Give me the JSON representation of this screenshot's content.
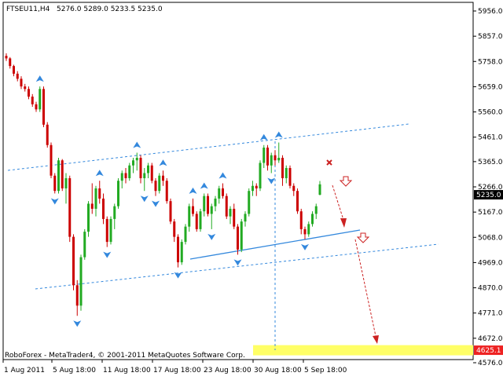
{
  "header": {
    "symbol_timeframe": "FTSEU11,H4",
    "ohlc": "5276.0 5289.0 5233.5 5235.0"
  },
  "footer": {
    "copyright": "RoboForex - MetaTrader4, © 2001-2011 MetaQuotes Software Corp."
  },
  "colors": {
    "background": "#ffffff",
    "candle_up": "#22aa22",
    "candle_down": "#cc0000",
    "trend_line": "#2277dd",
    "arrow": "#cc2222",
    "fractal": "#3388dd",
    "target_zone": "#ffff66",
    "current_price_label": "#000000",
    "target_price_label": "#ee2222"
  },
  "chart_data": {
    "type": "candlestick",
    "ylim": [
      4576.0,
      5956.0
    ],
    "y_ticks": [
      "5956.0",
      "5857.0",
      "5758.0",
      "5659.0",
      "5560.0",
      "5461.0",
      "5365.0",
      "5266.0",
      "5167.0",
      "5068.0",
      "4969.0",
      "4870.0",
      "4771.0",
      "4672.0",
      "4576.0"
    ],
    "x_labels": [
      "1 Aug 2011",
      "5 Aug 18:00",
      "11 Aug 18:00",
      "17 Aug 18:00",
      "23 Aug 18:00",
      "30 Aug 18:00",
      "5 Sep 18:00"
    ],
    "current_price": "5235.0",
    "target_price": "4625.1",
    "target_zone": [
      4605,
      4645
    ],
    "candles": [
      [
        5780,
        5790,
        5760,
        5770
      ],
      [
        5770,
        5775,
        5730,
        5740
      ],
      [
        5740,
        5745,
        5700,
        5710
      ],
      [
        5710,
        5720,
        5680,
        5690
      ],
      [
        5690,
        5700,
        5650,
        5660
      ],
      [
        5660,
        5670,
        5640,
        5650
      ],
      [
        5650,
        5660,
        5610,
        5620
      ],
      [
        5620,
        5630,
        5580,
        5590
      ],
      [
        5590,
        5600,
        5560,
        5570
      ],
      [
        5570,
        5660,
        5560,
        5650
      ],
      [
        5650,
        5660,
        5500,
        5510
      ],
      [
        5510,
        5520,
        5420,
        5430
      ],
      [
        5430,
        5440,
        5300,
        5310
      ],
      [
        5310,
        5320,
        5240,
        5250
      ],
      [
        5250,
        5380,
        5240,
        5370
      ],
      [
        5370,
        5375,
        5250,
        5260
      ],
      [
        5260,
        5320,
        5200,
        5300
      ],
      [
        5300,
        5310,
        5050,
        5070
      ],
      [
        5070,
        5080,
        4860,
        4880
      ],
      [
        4880,
        4900,
        4760,
        4800
      ],
      [
        4800,
        5000,
        4780,
        4990
      ],
      [
        4990,
        5100,
        4980,
        5090
      ],
      [
        5090,
        5210,
        5070,
        5200
      ],
      [
        5200,
        5280,
        5160,
        5180
      ],
      [
        5180,
        5270,
        5150,
        5260
      ],
      [
        5260,
        5290,
        5200,
        5220
      ],
      [
        5220,
        5240,
        5120,
        5140
      ],
      [
        5140,
        5150,
        5030,
        5050
      ],
      [
        5050,
        5150,
        5040,
        5140
      ],
      [
        5140,
        5200,
        5100,
        5190
      ],
      [
        5190,
        5300,
        5180,
        5290
      ],
      [
        5290,
        5330,
        5260,
        5320
      ],
      [
        5320,
        5340,
        5280,
        5300
      ],
      [
        5300,
        5360,
        5290,
        5350
      ],
      [
        5350,
        5380,
        5320,
        5370
      ],
      [
        5370,
        5400,
        5330,
        5380
      ],
      [
        5380,
        5390,
        5280,
        5300
      ],
      [
        5300,
        5340,
        5250,
        5320
      ],
      [
        5320,
        5360,
        5300,
        5350
      ],
      [
        5350,
        5360,
        5280,
        5290
      ],
      [
        5290,
        5300,
        5230,
        5250
      ],
      [
        5250,
        5320,
        5240,
        5310
      ],
      [
        5310,
        5330,
        5270,
        5290
      ],
      [
        5290,
        5300,
        5200,
        5210
      ],
      [
        5210,
        5220,
        5120,
        5130
      ],
      [
        5130,
        5140,
        5050,
        5070
      ],
      [
        5070,
        5080,
        4950,
        4970
      ],
      [
        4970,
        5060,
        4960,
        5050
      ],
      [
        5050,
        5120,
        5040,
        5110
      ],
      [
        5110,
        5200,
        5090,
        5190
      ],
      [
        5190,
        5220,
        5150,
        5160
      ],
      [
        5160,
        5170,
        5090,
        5100
      ],
      [
        5100,
        5180,
        5090,
        5170
      ],
      [
        5170,
        5240,
        5150,
        5230
      ],
      [
        5230,
        5240,
        5150,
        5160
      ],
      [
        5160,
        5200,
        5100,
        5190
      ],
      [
        5190,
        5230,
        5170,
        5220
      ],
      [
        5220,
        5270,
        5200,
        5260
      ],
      [
        5260,
        5280,
        5220,
        5230
      ],
      [
        5230,
        5240,
        5140,
        5150
      ],
      [
        5150,
        5190,
        5120,
        5180
      ],
      [
        5180,
        5200,
        5100,
        5110
      ],
      [
        5110,
        5120,
        5000,
        5020
      ],
      [
        5020,
        5140,
        5010,
        5130
      ],
      [
        5130,
        5170,
        5110,
        5160
      ],
      [
        5160,
        5260,
        5150,
        5250
      ],
      [
        5250,
        5290,
        5230,
        5270
      ],
      [
        5270,
        5280,
        5230,
        5260
      ],
      [
        5260,
        5370,
        5250,
        5360
      ],
      [
        5360,
        5430,
        5340,
        5420
      ],
      [
        5420,
        5430,
        5330,
        5350
      ],
      [
        5350,
        5400,
        5320,
        5390
      ],
      [
        5390,
        5410,
        5350,
        5370
      ],
      [
        5370,
        5440,
        5360,
        5380
      ],
      [
        5380,
        5390,
        5270,
        5300
      ],
      [
        5300,
        5350,
        5280,
        5340
      ],
      [
        5340,
        5350,
        5260,
        5270
      ],
      [
        5270,
        5280,
        5230,
        5250
      ],
      [
        5250,
        5260,
        5160,
        5170
      ],
      [
        5170,
        5180,
        5080,
        5100
      ],
      [
        5100,
        5110,
        5060,
        5080
      ],
      [
        5080,
        5130,
        5070,
        5120
      ],
      [
        5120,
        5170,
        5110,
        5160
      ],
      [
        5160,
        5200,
        5140,
        5190
      ],
      [
        5235,
        5289,
        5233,
        5276
      ]
    ]
  }
}
